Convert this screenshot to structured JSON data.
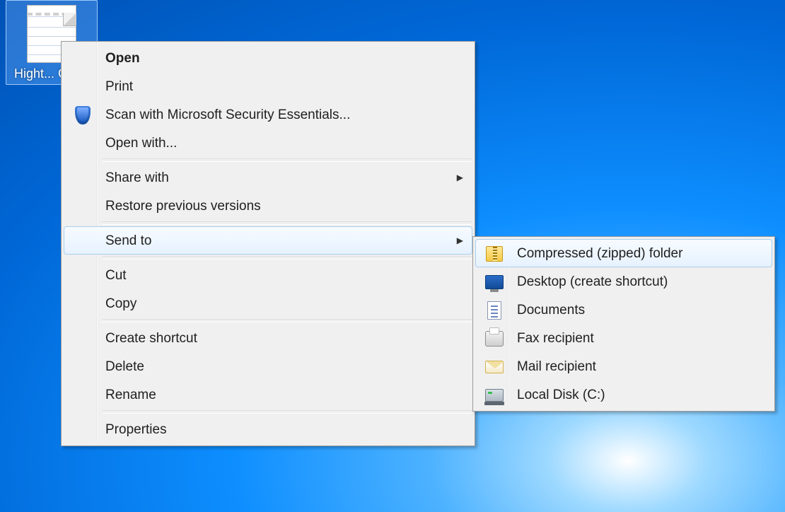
{
  "desktop_icon": {
    "label": "Hight... Out..."
  },
  "context_menu": {
    "open": "Open",
    "print": "Print",
    "scan": "Scan with Microsoft Security Essentials...",
    "open_with": "Open with...",
    "share_with": "Share with",
    "restore": "Restore previous versions",
    "send_to": "Send to",
    "cut": "Cut",
    "copy": "Copy",
    "create_shortcut": "Create shortcut",
    "delete": "Delete",
    "rename": "Rename",
    "properties": "Properties"
  },
  "send_to_submenu": {
    "zip": "Compressed (zipped) folder",
    "desktop": "Desktop (create shortcut)",
    "documents": "Documents",
    "fax": "Fax recipient",
    "mail": "Mail recipient",
    "disk": "Local Disk (C:)"
  }
}
